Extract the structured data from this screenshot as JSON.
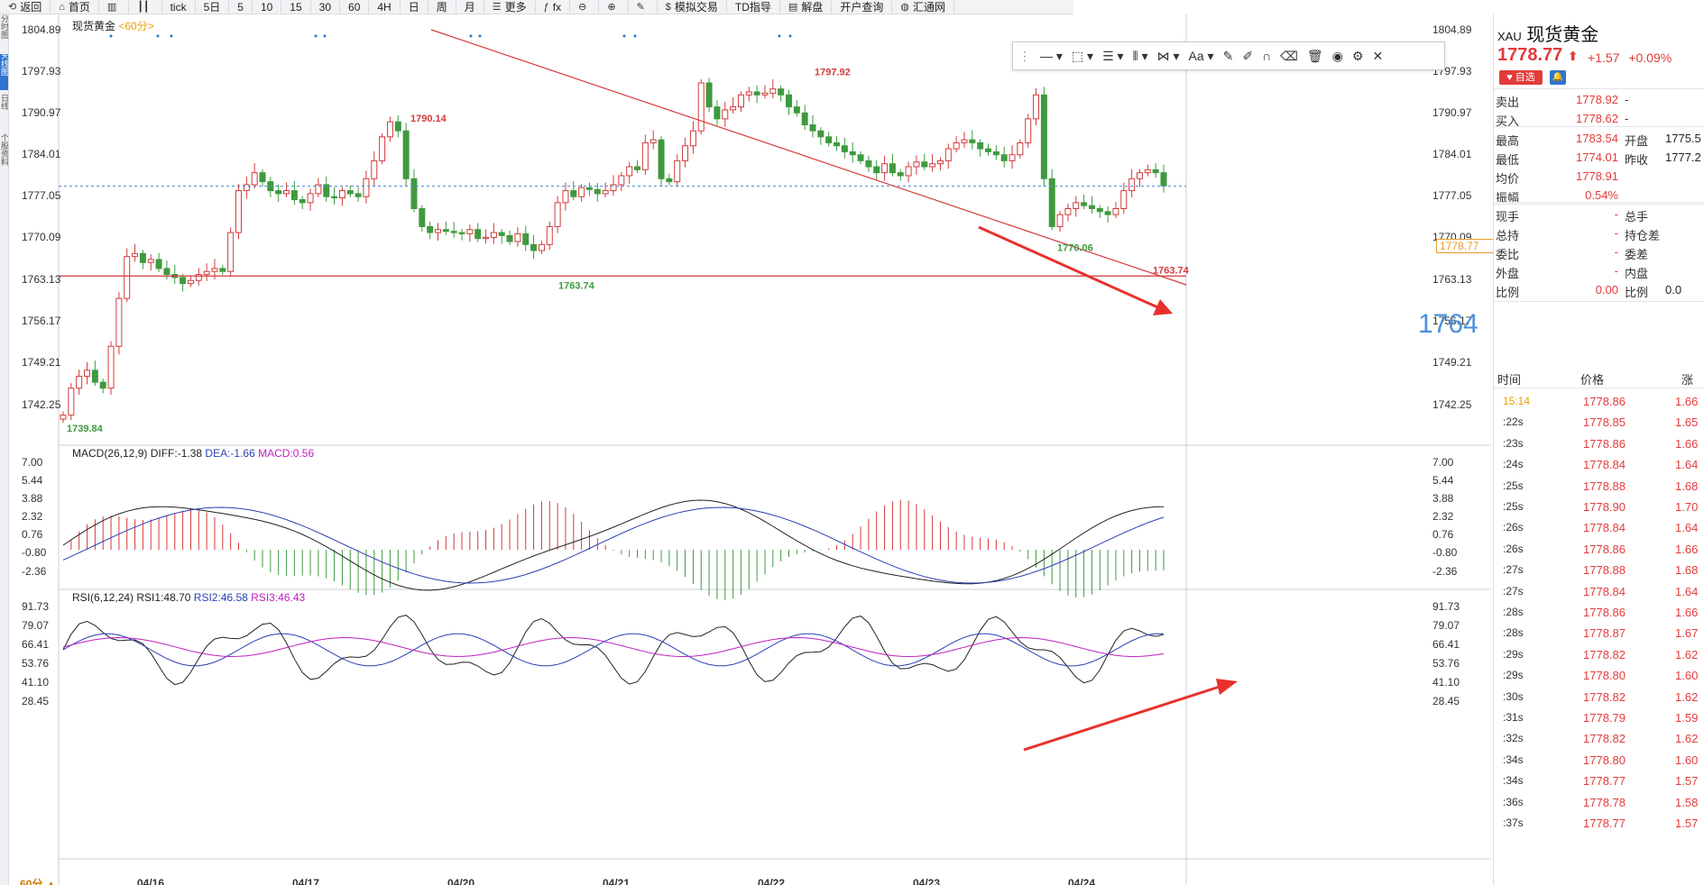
{
  "toolbar": {
    "items": [
      {
        "label": "返回",
        "icon": "back-icon"
      },
      {
        "label": "首页",
        "icon": "home-icon"
      },
      {
        "label": "",
        "icon": "chart-bar-icon"
      },
      {
        "label": "",
        "icon": "candle-icon"
      },
      {
        "label": "tick"
      },
      {
        "label": "5日"
      },
      {
        "label": "5"
      },
      {
        "label": "10"
      },
      {
        "label": "15"
      },
      {
        "label": "30"
      },
      {
        "label": "60"
      },
      {
        "label": "4H"
      },
      {
        "label": "日"
      },
      {
        "label": "周"
      },
      {
        "label": "月"
      },
      {
        "label": "更多",
        "icon": "list-icon"
      },
      {
        "label": "fx",
        "icon": "formula-icon"
      },
      {
        "label": "",
        "icon": "zoom-out-icon"
      },
      {
        "label": "",
        "icon": "zoom-in-icon"
      },
      {
        "label": "",
        "icon": "pen-icon"
      },
      {
        "label": "模拟交易",
        "icon": "dollar-icon"
      },
      {
        "label": "TD指导"
      },
      {
        "label": "解盘",
        "icon": "doc-icon"
      },
      {
        "label": "开户查询"
      },
      {
        "label": "汇通网",
        "icon": "globe-icon"
      }
    ]
  },
  "chart_title": {
    "name": "现货黄金",
    "period": "<60分>"
  },
  "price_axis": [
    "1804.89",
    "1797.93",
    "1790.97",
    "1784.01",
    "1777.05",
    "1770.09",
    "1763.13",
    "1756.17",
    "1749.21",
    "1742.25"
  ],
  "macd_axis": [
    "7.00",
    "5.44",
    "3.88",
    "2.32",
    "0.76",
    "-0.80",
    "-2.36"
  ],
  "rsi_axis": [
    "91.73",
    "79.07",
    "66.41",
    "53.76",
    "41.10",
    "28.45"
  ],
  "macd_label": {
    "name": "MACD(26,12,9)",
    "diff": "DIFF:-1.38",
    "dea": "DEA:-1.66",
    "macd": "MACD:0.56"
  },
  "rsi_label": {
    "name": "RSI(6,12,24)",
    "rsi1": "RSI1:48.70",
    "rsi2": "RSI2:46.58",
    "rsi3": "RSI3:46.43"
  },
  "annotations": {
    "high1": "1790.14",
    "high2": "1797.92",
    "low1": "1739.84",
    "low2": "1763.74",
    "low3": "1770.06",
    "line_label": "1763.74",
    "big_label": "1764"
  },
  "current_price_tag": "1778.77",
  "x_labels": [
    "04/16",
    "04/17",
    "04/20",
    "04/21",
    "04/22",
    "04/23",
    "04/24"
  ],
  "period_tag": "60分 ▲",
  "left_tabs": [
    "分时图",
    "K线图",
    "日线",
    "个股资料"
  ],
  "colors": {
    "up": "#d33a3a",
    "down": "#3f9a3f",
    "accent": "#2f74d0",
    "line": "#d33a3a"
  },
  "quote": {
    "code": "XAU",
    "name": "现货黄金",
    "price": "1778.77",
    "arrow": "⬆",
    "change": "+1.57",
    "change_pct": "+0.09%",
    "fav_label": "自选",
    "rows": [
      {
        "l1": "卖出",
        "v1": "1778.92",
        "l2": "-",
        "v2": ""
      },
      {
        "l1": "买入",
        "v1": "1778.62",
        "l2": "-",
        "v2": ""
      },
      {
        "l1": "最高",
        "v1": "1783.54",
        "l2": "开盘",
        "v2": "1775.5"
      },
      {
        "l1": "最低",
        "v1": "1774.01",
        "l2": "昨收",
        "v2": "1777.2"
      },
      {
        "l1": "均价",
        "v1": "1778.91",
        "l2": "",
        "v2": ""
      },
      {
        "l1": "振幅",
        "v1": "0.54%",
        "l2": "",
        "v2": ""
      },
      {
        "l1": "现手",
        "v1": "-",
        "l2": "总手",
        "v2": ""
      },
      {
        "l1": "总持",
        "v1": "-",
        "l2": "持仓差",
        "v2": ""
      },
      {
        "l1": "委比",
        "v1": "-",
        "l2": "委差",
        "v2": ""
      },
      {
        "l1": "外盘",
        "v1": "-",
        "l2": "内盘",
        "v2": ""
      },
      {
        "l1": "比例",
        "v1": "0.00",
        "l2": "比例",
        "v2": "0.0"
      }
    ],
    "tick_headers": {
      "time": "时间",
      "price": "价格",
      "change": "涨"
    },
    "ticks": [
      {
        "time": "15:14",
        "price": "1778.86",
        "change": "1.66"
      },
      {
        "time": ":22s",
        "price": "1778.85",
        "change": "1.65"
      },
      {
        "time": ":23s",
        "price": "1778.86",
        "change": "1.66"
      },
      {
        "time": ":24s",
        "price": "1778.84",
        "change": "1.64"
      },
      {
        "time": ":25s",
        "price": "1778.88",
        "change": "1.68"
      },
      {
        "time": ":25s",
        "price": "1778.90",
        "change": "1.70"
      },
      {
        "time": ":26s",
        "price": "1778.84",
        "change": "1.64"
      },
      {
        "time": ":26s",
        "price": "1778.86",
        "change": "1.66"
      },
      {
        "time": ":27s",
        "price": "1778.88",
        "change": "1.68"
      },
      {
        "time": ":27s",
        "price": "1778.84",
        "change": "1.64"
      },
      {
        "time": ":28s",
        "price": "1778.86",
        "change": "1.66"
      },
      {
        "time": ":28s",
        "price": "1778.87",
        "change": "1.67"
      },
      {
        "time": ":29s",
        "price": "1778.82",
        "change": "1.62"
      },
      {
        "time": ":29s",
        "price": "1778.80",
        "change": "1.60"
      },
      {
        "time": ":30s",
        "price": "1778.82",
        "change": "1.62"
      },
      {
        "time": ":31s",
        "price": "1778.79",
        "change": "1.59"
      },
      {
        "time": ":32s",
        "price": "1778.82",
        "change": "1.62"
      },
      {
        "time": ":34s",
        "price": "1778.80",
        "change": "1.60"
      },
      {
        "time": ":34s",
        "price": "1778.77",
        "change": "1.57"
      },
      {
        "time": ":36s",
        "price": "1778.78",
        "change": "1.58"
      },
      {
        "time": ":37s",
        "price": "1778.77",
        "change": "1.57"
      }
    ]
  }
}
